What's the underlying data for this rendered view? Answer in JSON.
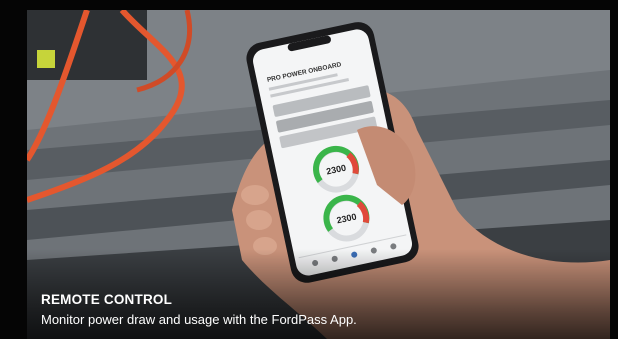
{
  "caption": {
    "title": "REMOTE CONTROL",
    "subtitle": "Monitor power draw and usage with the FordPass App."
  },
  "phone": {
    "screen_title": "PRO POWER ONBOARD",
    "gauges": [
      {
        "value": "2300"
      },
      {
        "value": "2300"
      }
    ]
  },
  "colors": {
    "background": "#050505",
    "caption_text": "#ffffff",
    "cable": "#e4572e",
    "gauge_green": "#3ab54a",
    "gauge_red": "#e0493a"
  }
}
